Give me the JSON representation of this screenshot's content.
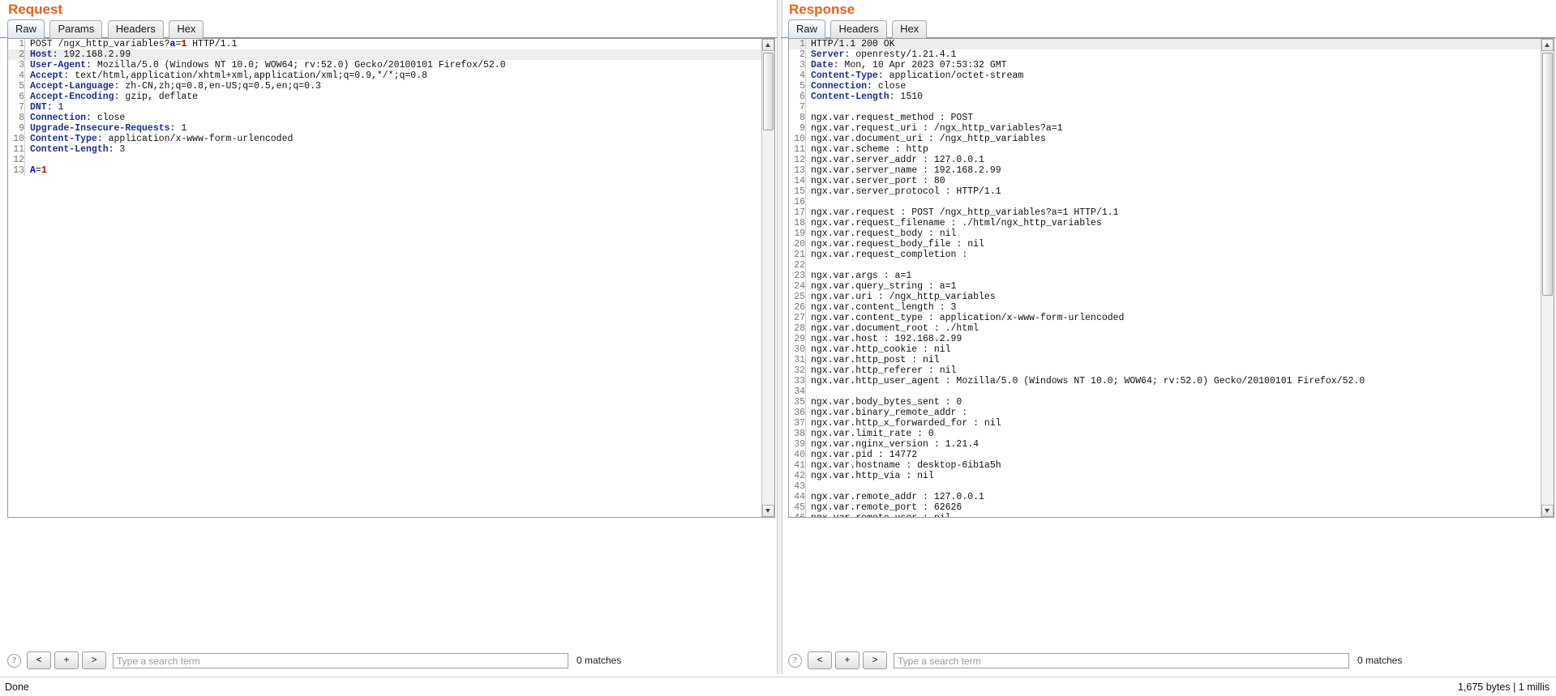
{
  "request": {
    "title": "Request",
    "tabs": [
      {
        "label": "Raw",
        "active": true
      },
      {
        "label": "Params",
        "active": false
      },
      {
        "label": "Headers",
        "active": false
      },
      {
        "label": "Hex",
        "active": false
      }
    ],
    "lines": [
      {
        "n": 1,
        "parts": [
          {
            "t": "POST /ngx_http_variables?",
            "c": "txt"
          },
          {
            "t": "a",
            "c": "k-param"
          },
          {
            "t": "=",
            "c": "txt"
          },
          {
            "t": "1",
            "c": "k-val"
          },
          {
            "t": " HTTP/1.1",
            "c": "txt"
          }
        ]
      },
      {
        "n": 2,
        "hl": true,
        "parts": [
          {
            "t": "Host",
            "c": "k-hdr"
          },
          {
            "t": ": 192.168.2.99",
            "c": "txt"
          }
        ]
      },
      {
        "n": 3,
        "parts": [
          {
            "t": "User-Agent",
            "c": "k-hdr"
          },
          {
            "t": ": Mozilla/5.0 (Windows NT 10.0; WOW64; rv:52.0) Gecko/20100101 Firefox/52.0",
            "c": "txt"
          }
        ]
      },
      {
        "n": 4,
        "parts": [
          {
            "t": "Accept",
            "c": "k-hdr"
          },
          {
            "t": ": text/html,application/xhtml+xml,application/xml;q=0.9,*/*;q=0.8",
            "c": "txt"
          }
        ]
      },
      {
        "n": 5,
        "parts": [
          {
            "t": "Accept-Language",
            "c": "k-hdr"
          },
          {
            "t": ": zh-CN,zh;q=0.8,en-US;q=0.5,en;q=0.3",
            "c": "txt"
          }
        ]
      },
      {
        "n": 6,
        "parts": [
          {
            "t": "Accept-Encoding",
            "c": "k-hdr"
          },
          {
            "t": ": gzip, deflate",
            "c": "txt"
          }
        ]
      },
      {
        "n": 7,
        "parts": [
          {
            "t": "DNT",
            "c": "k-hdr"
          },
          {
            "t": ": 1",
            "c": "txt"
          }
        ]
      },
      {
        "n": 8,
        "parts": [
          {
            "t": "Connection",
            "c": "k-hdr"
          },
          {
            "t": ": close",
            "c": "txt"
          }
        ]
      },
      {
        "n": 9,
        "parts": [
          {
            "t": "Upgrade-Insecure-Requests",
            "c": "k-hdr"
          },
          {
            "t": ": 1",
            "c": "txt"
          }
        ]
      },
      {
        "n": 10,
        "parts": [
          {
            "t": "Content-Type",
            "c": "k-hdr"
          },
          {
            "t": ": application/x-www-form-urlencoded",
            "c": "txt"
          }
        ]
      },
      {
        "n": 11,
        "parts": [
          {
            "t": "Content-Length",
            "c": "k-hdr"
          },
          {
            "t": ": 3",
            "c": "txt"
          }
        ]
      },
      {
        "n": 12,
        "parts": []
      },
      {
        "n": 13,
        "parts": [
          {
            "t": "A",
            "c": "k-param"
          },
          {
            "t": "=",
            "c": "txt"
          },
          {
            "t": "1",
            "c": "k-val"
          }
        ]
      }
    ],
    "search": {
      "help": "?",
      "prev_label": "<",
      "add_label": "+",
      "next_label": ">",
      "placeholder": "Type a search term",
      "value": "",
      "matches": "0 matches"
    }
  },
  "response": {
    "title": "Response",
    "tabs": [
      {
        "label": "Raw",
        "active": true
      },
      {
        "label": "Headers",
        "active": false
      },
      {
        "label": "Hex",
        "active": false
      }
    ],
    "lines": [
      {
        "n": 1,
        "hl": true,
        "parts": [
          {
            "t": "HTTP/1.1 200 OK",
            "c": "txt"
          }
        ]
      },
      {
        "n": 2,
        "parts": [
          {
            "t": "Server",
            "c": "k-hdr"
          },
          {
            "t": ": openresty/1.21.4.1",
            "c": "txt"
          }
        ]
      },
      {
        "n": 3,
        "parts": [
          {
            "t": "Date",
            "c": "k-hdr"
          },
          {
            "t": ": Mon, 10 Apr 2023 07:53:32 GMT",
            "c": "txt"
          }
        ]
      },
      {
        "n": 4,
        "parts": [
          {
            "t": "Content-Type",
            "c": "k-hdr"
          },
          {
            "t": ": application/octet-stream",
            "c": "txt"
          }
        ]
      },
      {
        "n": 5,
        "parts": [
          {
            "t": "Connection",
            "c": "k-hdr"
          },
          {
            "t": ": close",
            "c": "txt"
          }
        ]
      },
      {
        "n": 6,
        "parts": [
          {
            "t": "Content-Length",
            "c": "k-hdr"
          },
          {
            "t": ": 1510",
            "c": "txt"
          }
        ]
      },
      {
        "n": 7,
        "parts": []
      },
      {
        "n": 8,
        "parts": [
          {
            "t": "ngx.var.request_method : POST",
            "c": "txt"
          }
        ]
      },
      {
        "n": 9,
        "parts": [
          {
            "t": "ngx.var.request_uri : /ngx_http_variables?a=1",
            "c": "txt"
          }
        ]
      },
      {
        "n": 10,
        "parts": [
          {
            "t": "ngx.var.document_uri : /ngx_http_variables",
            "c": "txt"
          }
        ]
      },
      {
        "n": 11,
        "parts": [
          {
            "t": "ngx.var.scheme : http",
            "c": "txt"
          }
        ]
      },
      {
        "n": 12,
        "parts": [
          {
            "t": "ngx.var.server_addr : 127.0.0.1",
            "c": "txt"
          }
        ]
      },
      {
        "n": 13,
        "parts": [
          {
            "t": "ngx.var.server_name : 192.168.2.99",
            "c": "txt"
          }
        ]
      },
      {
        "n": 14,
        "parts": [
          {
            "t": "ngx.var.server_port : 80",
            "c": "txt"
          }
        ]
      },
      {
        "n": 15,
        "parts": [
          {
            "t": "ngx.var.server_protocol : HTTP/1.1",
            "c": "txt"
          }
        ]
      },
      {
        "n": 16,
        "parts": []
      },
      {
        "n": 17,
        "parts": [
          {
            "t": "ngx.var.request : POST /ngx_http_variables?a=1 HTTP/1.1",
            "c": "txt"
          }
        ]
      },
      {
        "n": 18,
        "parts": [
          {
            "t": "ngx.var.request_filename : ./html/ngx_http_variables",
            "c": "txt"
          }
        ]
      },
      {
        "n": 19,
        "parts": [
          {
            "t": "ngx.var.request_body : nil",
            "c": "txt"
          }
        ]
      },
      {
        "n": 20,
        "parts": [
          {
            "t": "ngx.var.request_body_file : nil",
            "c": "txt"
          }
        ]
      },
      {
        "n": 21,
        "parts": [
          {
            "t": "ngx.var.request_completion : ",
            "c": "txt"
          }
        ]
      },
      {
        "n": 22,
        "parts": []
      },
      {
        "n": 23,
        "parts": [
          {
            "t": "ngx.var.args : a=1",
            "c": "txt"
          }
        ]
      },
      {
        "n": 24,
        "parts": [
          {
            "t": "ngx.var.query_string : a=1",
            "c": "txt"
          }
        ]
      },
      {
        "n": 25,
        "parts": [
          {
            "t": "ngx.var.uri : /ngx_http_variables",
            "c": "txt"
          }
        ]
      },
      {
        "n": 26,
        "parts": [
          {
            "t": "ngx.var.content_length : 3",
            "c": "txt"
          }
        ]
      },
      {
        "n": 27,
        "parts": [
          {
            "t": "ngx.var.content_type : application/x-www-form-urlencoded",
            "c": "txt"
          }
        ]
      },
      {
        "n": 28,
        "parts": [
          {
            "t": "ngx.var.document_root : ./html",
            "c": "txt"
          }
        ]
      },
      {
        "n": 29,
        "parts": [
          {
            "t": "ngx.var.host : 192.168.2.99",
            "c": "txt"
          }
        ]
      },
      {
        "n": 30,
        "parts": [
          {
            "t": "ngx.var.http_cookie : nil",
            "c": "txt"
          }
        ]
      },
      {
        "n": 31,
        "parts": [
          {
            "t": "ngx.var.http_post : nil",
            "c": "txt"
          }
        ]
      },
      {
        "n": 32,
        "parts": [
          {
            "t": "ngx.var.http_referer : nil",
            "c": "txt"
          }
        ]
      },
      {
        "n": 33,
        "parts": [
          {
            "t": "ngx.var.http_user_agent : Mozilla/5.0 (Windows NT 10.0; WOW64; rv:52.0) Gecko/20100101 Firefox/52.0",
            "c": "txt"
          }
        ]
      },
      {
        "n": 34,
        "parts": []
      },
      {
        "n": 35,
        "parts": [
          {
            "t": "ngx.var.body_bytes_sent : 0",
            "c": "txt"
          }
        ]
      },
      {
        "n": 36,
        "parts": [
          {
            "t": "ngx.var.binary_remote_addr : ",
            "c": "txt"
          }
        ]
      },
      {
        "n": 37,
        "parts": [
          {
            "t": "ngx.var.http_x_forwarded_for : nil",
            "c": "txt"
          }
        ]
      },
      {
        "n": 38,
        "parts": [
          {
            "t": "ngx.var.limit_rate : 0",
            "c": "txt"
          }
        ]
      },
      {
        "n": 39,
        "parts": [
          {
            "t": "ngx.var.nginx_version : 1.21.4",
            "c": "txt"
          }
        ]
      },
      {
        "n": 40,
        "parts": [
          {
            "t": "ngx.var.pid : 14772",
            "c": "txt"
          }
        ]
      },
      {
        "n": 41,
        "parts": [
          {
            "t": "ngx.var.hostname : desktop-6ib1a5h",
            "c": "txt"
          }
        ]
      },
      {
        "n": 42,
        "parts": [
          {
            "t": "ngx.var.http_via : nil",
            "c": "txt"
          }
        ]
      },
      {
        "n": 43,
        "parts": []
      },
      {
        "n": 44,
        "parts": [
          {
            "t": "ngx.var.remote_addr : 127.0.0.1",
            "c": "txt"
          }
        ]
      },
      {
        "n": 45,
        "parts": [
          {
            "t": "ngx.var.remote_port : 62626",
            "c": "txt"
          }
        ]
      },
      {
        "n": 46,
        "parts": [
          {
            "t": "ngx.var.remote_user : nil",
            "c": "txt"
          }
        ]
      }
    ],
    "search": {
      "help": "?",
      "prev_label": "<",
      "add_label": "+",
      "next_label": ">",
      "placeholder": "Type a search term",
      "value": "",
      "matches": "0 matches"
    }
  },
  "statusbar": {
    "left": "Done",
    "right": "1,675 bytes | 1 millis"
  },
  "colors": {
    "title_orange": "#e8601c",
    "header_blue": "#1c2f8c",
    "param_blue": "#0b00c8",
    "value_red": "#c00000"
  }
}
